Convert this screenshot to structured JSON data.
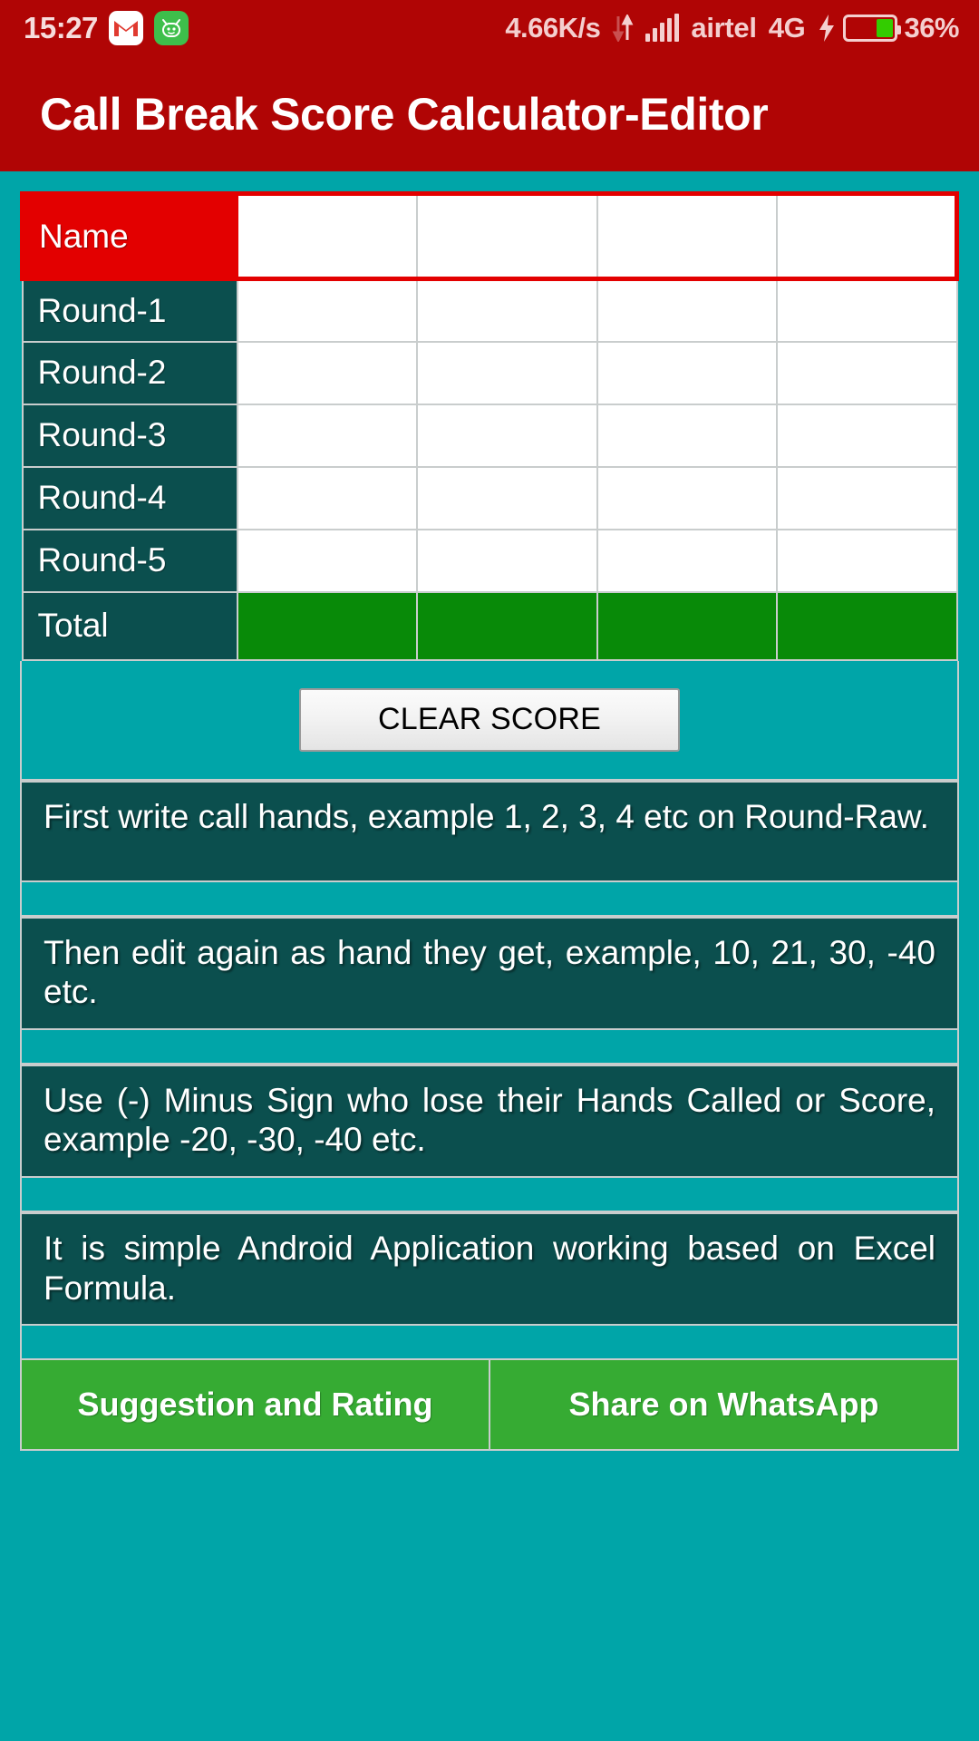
{
  "status_bar": {
    "clock": "15:27",
    "icons": [
      "gmail-icon",
      "android-app-icon"
    ],
    "network_speed": "4.66K/s",
    "data_arrows_icon": "data-transfer-arrows-icon",
    "signal_icon": "signal-bars-icon",
    "carrier": "airtel",
    "network_type": "4G",
    "charging_icon": "charging-bolt-icon",
    "battery_percent": "36%",
    "battery_level": 36,
    "colors": {
      "bar_background": "#b00505",
      "text": "#f4cfcf",
      "battery_fill": "#33cc00"
    }
  },
  "app_bar": {
    "title": "Call Break Score Calculator-Editor",
    "background": "#b00505",
    "title_color": "#ffffff"
  },
  "score_table": {
    "rows": [
      {
        "label": "Name",
        "type": "name",
        "values": [
          "",
          "",
          "",
          ""
        ]
      },
      {
        "label": "Round-1",
        "type": "input",
        "values": [
          "",
          "",
          "",
          ""
        ]
      },
      {
        "label": "Round-2",
        "type": "input",
        "values": [
          "",
          "",
          "",
          ""
        ]
      },
      {
        "label": "Round-3",
        "type": "input",
        "values": [
          "",
          "",
          "",
          ""
        ]
      },
      {
        "label": "Round-4",
        "type": "input",
        "values": [
          "",
          "",
          "",
          ""
        ]
      },
      {
        "label": "Round-5",
        "type": "input",
        "values": [
          "",
          "",
          "",
          ""
        ]
      },
      {
        "label": "Total",
        "type": "total",
        "values": [
          "",
          "",
          "",
          ""
        ]
      }
    ],
    "player_count": 4,
    "colors": {
      "label_background": "#0b4f4e",
      "name_highlight": "#e30000",
      "total_background": "#088a08",
      "cell_background": "#ffffff",
      "grid_line": "#c9cdcd"
    }
  },
  "clear_button": {
    "label": "CLEAR SCORE"
  },
  "instructions": [
    "First write call hands, example 1, 2, 3, 4 etc on Round-Raw.",
    "Then edit again as hand they get, example, 10, 21, 30, -40 etc.",
    "Use (-) Minus Sign who lose their Hands Called or Score, example -20, -30, -40 etc.",
    "It is simple Android Application working based on Excel Formula."
  ],
  "actions": {
    "suggestion_label": "Suggestion and Rating",
    "share_label": "Share on WhatsApp",
    "button_color": "#36ab33"
  },
  "theme": {
    "page_background": "#00a5a8"
  }
}
